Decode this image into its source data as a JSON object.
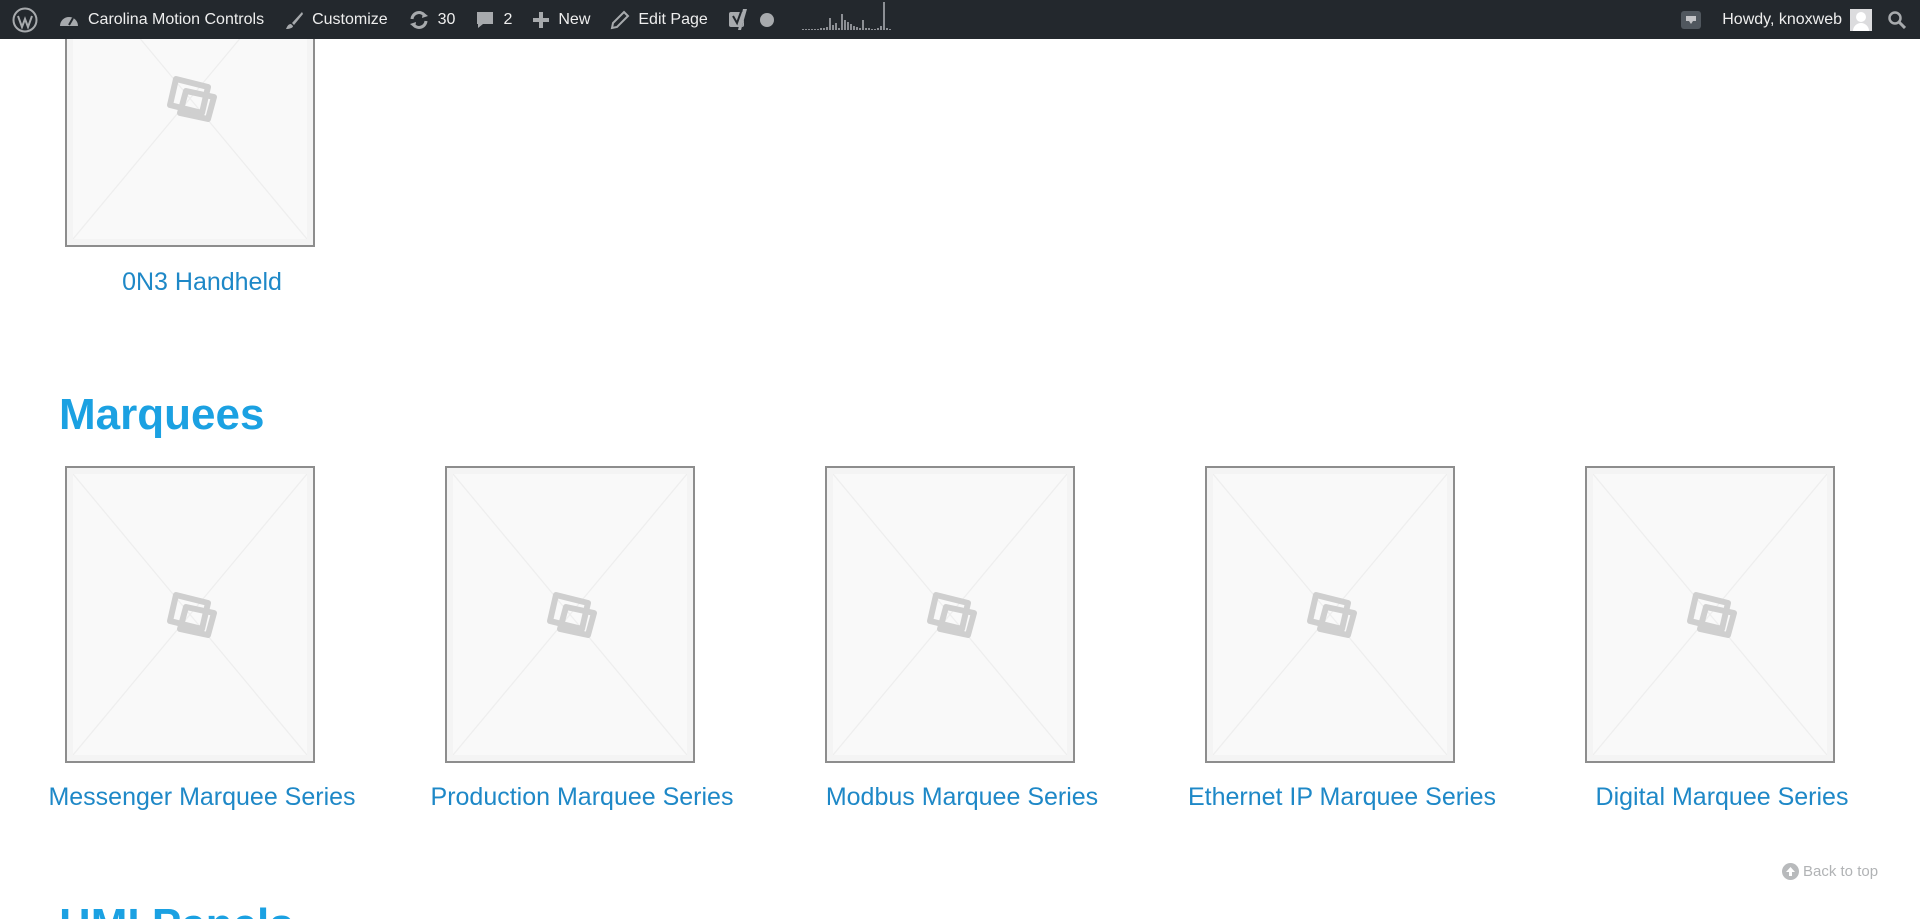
{
  "adminbar": {
    "wp_logo_icon": "wordpress-icon",
    "site_name": "Carolina Motion Controls",
    "customize_label": "Customize",
    "updates_count": "30",
    "comments_count": "2",
    "new_label": "New",
    "edit_page_label": "Edit Page",
    "greeting": "Howdy, knoxweb",
    "colors": {
      "background": "#23282d",
      "text": "#eeeeee"
    }
  },
  "sections": [
    {
      "heading": "",
      "products": [
        {
          "title": "0N3 Handheld",
          "image": "placeholder-image-icon"
        }
      ]
    },
    {
      "heading": "Marquees",
      "products": [
        {
          "title": "Messenger Marquee Series",
          "image": "placeholder-image-icon"
        },
        {
          "title": "Production Marquee Series",
          "image": "placeholder-image-icon"
        },
        {
          "title": "Modbus Marquee Series",
          "image": "placeholder-image-icon"
        },
        {
          "title": "Ethernet IP Marquee Series",
          "image": "placeholder-image-icon"
        },
        {
          "title": "Digital Marquee Series",
          "image": "placeholder-image-icon"
        }
      ]
    },
    {
      "heading": "HMI Panels"
    }
  ],
  "back_to_top": "Back to top",
  "colors": {
    "link": "#1e88c7",
    "heading": "#1ba1e2"
  }
}
